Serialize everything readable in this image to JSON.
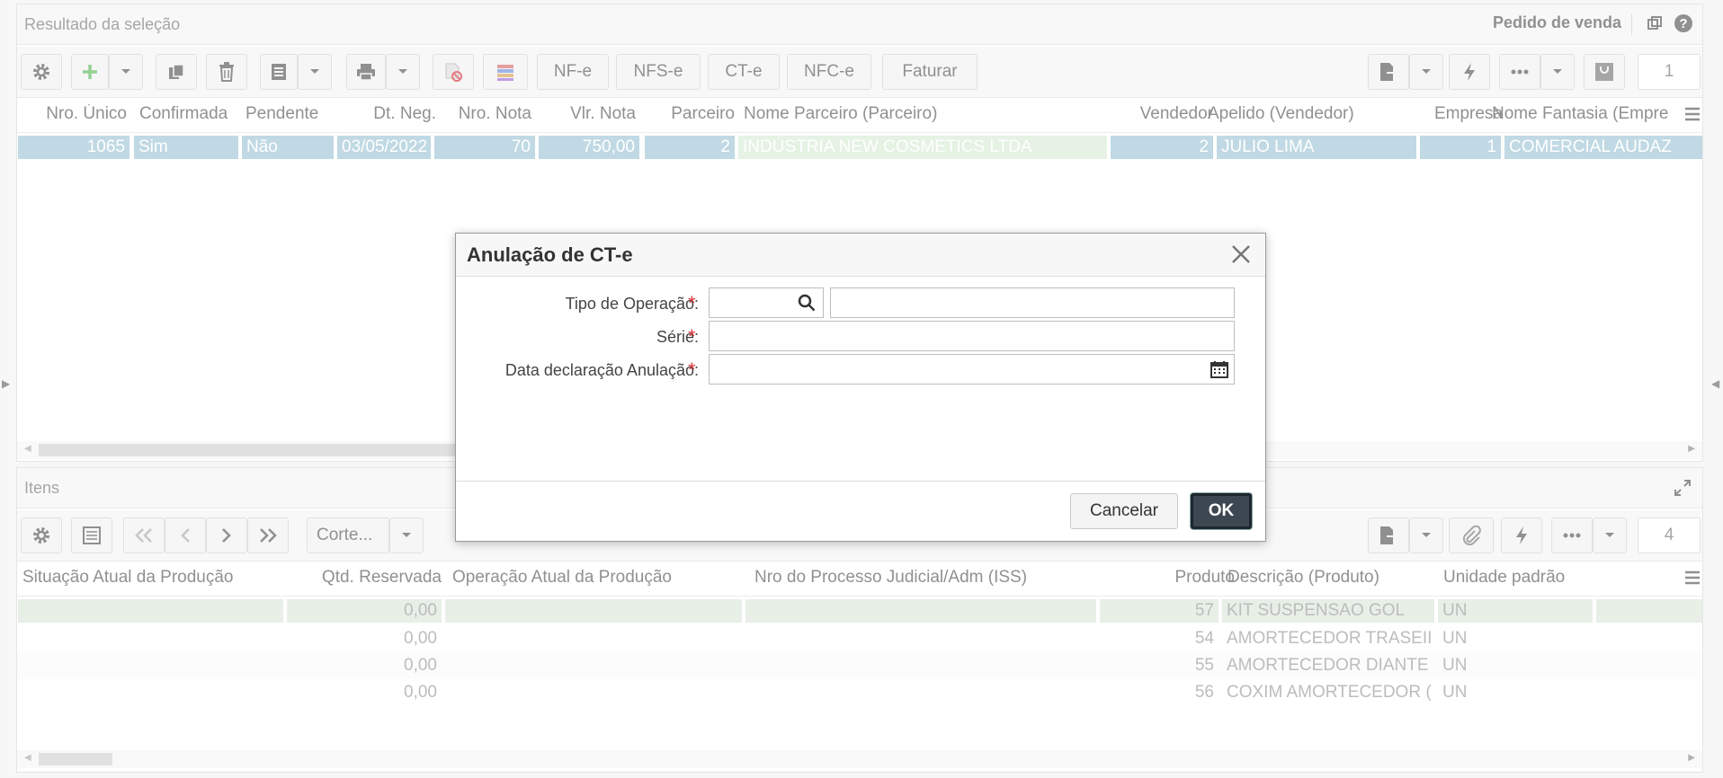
{
  "top_panel": {
    "title": "Resultado da seleção",
    "context_label": "Pedido de venda",
    "toolbar": {
      "buttons": [
        "NF-e",
        "NFS-e",
        "CT-e",
        "NFC-e",
        "Faturar"
      ],
      "page_number": "1"
    },
    "columns": [
      "Nro. Único",
      "Confirmada",
      "Pendente",
      "Dt. Neg.",
      "Nro. Nota",
      "Vlr. Nota",
      "Parceiro",
      "Nome Parceiro (Parceiro)",
      "Vendedor",
      "Apelido (Vendedor)",
      "Empresa",
      "Nome Fantasia (Empre"
    ],
    "rows": [
      [
        "1065",
        "Sim",
        "Não",
        "03/05/2022",
        "70",
        "750,00",
        "2",
        "INDÚSTRIA NEW COSMETICS LTDA",
        "2",
        "JULIO LIMA",
        "1",
        "COMERCIAL AUDAZ"
      ]
    ]
  },
  "bottom_panel": {
    "title": "Itens",
    "toolbar": {
      "corte_label": "Corte...",
      "page_number": "4"
    },
    "columns": [
      "Situação Atual da Produção",
      "Qtd. Reservada",
      "Operação Atual da Produção",
      "Nro do Processo Judicial/Adm (ISS)",
      "Produto",
      "Descrição (Produto)",
      "Unidade padrão"
    ],
    "rows": [
      [
        "",
        "0,00",
        "",
        "",
        "57",
        "KIT SUSPENSAO GOL",
        "UN"
      ],
      [
        "",
        "0,00",
        "",
        "",
        "54",
        "AMORTECEDOR TRASEII",
        "UN"
      ],
      [
        "",
        "0,00",
        "",
        "",
        "55",
        "AMORTECEDOR DIANTE",
        "UN"
      ],
      [
        "",
        "0,00",
        "",
        "",
        "56",
        "COXIM AMORTECEDOR (",
        "UN"
      ]
    ]
  },
  "dialog": {
    "title": "Anulação de CT-e",
    "fields": {
      "tipo_operacao": {
        "label": "Tipo de Operação:",
        "value": "",
        "description": ""
      },
      "serie": {
        "label": "Série:",
        "value": ""
      },
      "data_anulacao": {
        "label": "Data declaração Anulação:",
        "value": ""
      }
    },
    "required_mark": "*",
    "cancel_label": "Cancelar",
    "ok_label": "OK"
  },
  "colors": {
    "selected_row": "#9fc5d6",
    "partner_cell": "#d8ecd6",
    "required": "#d9363e",
    "ok_button": "#3d4752"
  }
}
